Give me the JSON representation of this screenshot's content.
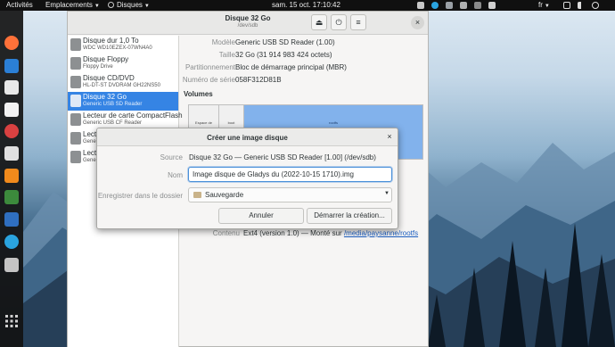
{
  "topbar": {
    "activities": "Activités",
    "places": "Emplacements",
    "app_menu": "Disques",
    "clock": "sam. 15 oct.  17:10:42",
    "language": "fr"
  },
  "disks_window": {
    "title": "Disque 32 Go",
    "subtitle": "/dev/sdb",
    "devices": [
      {
        "name": "Disque dur 1,0 To",
        "detail": "WDC WD10EZEX-07WN4A0"
      },
      {
        "name": "Disque Floppy",
        "detail": "Floppy Drive"
      },
      {
        "name": "Disque CD/DVD",
        "detail": "HL-DT-ST DVDRAM GH22NS50"
      },
      {
        "name": "Disque 32 Go",
        "detail": "Generic USB SD Reader"
      },
      {
        "name": "Lecteur de carte CompactFlash",
        "detail": "Generic USB CF Reader"
      },
      {
        "name": "Lecte",
        "detail": "Gene"
      },
      {
        "name": "Lecte",
        "detail": "Gene"
      }
    ],
    "info": [
      {
        "label": "Modèle",
        "value": "Generic USB SD Reader (1.00)"
      },
      {
        "label": "Taille",
        "value": "32 Go (31 914 983 424 octets)"
      },
      {
        "label": "Partitionnement",
        "value": "Bloc de démarrage principal (MBR)"
      },
      {
        "label": "Numéro de série",
        "value": "058F312D81B"
      }
    ],
    "volumes_title": "Volumes",
    "volume_segments": [
      "Espace de",
      "boot",
      "rootfs"
    ],
    "contenu_label": "Contenu",
    "contenu_value": "Ext4 (version 1.0) — Monté sur ",
    "contenu_link": "/media/paysanne/rootfs"
  },
  "dialog": {
    "title": "Créer une image disque",
    "source_label": "Source",
    "source_value": "Disque 32 Go — Generic USB SD Reader [1.00] (/dev/sdb)",
    "name_label": "Nom",
    "name_value": "Image disque de Gladys du (2022-10-15 1710).img",
    "folder_label": "Enregistrer dans le dossier",
    "folder_value": "Sauvegarde",
    "cancel_label": "Annuler",
    "start_label": "Démarrer la création..."
  }
}
